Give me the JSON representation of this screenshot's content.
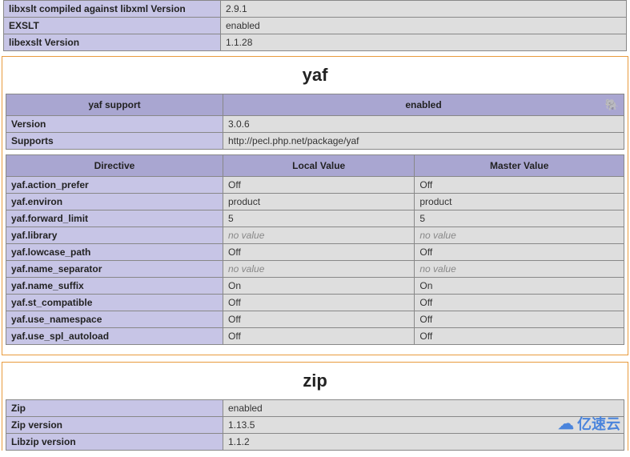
{
  "top_rows": [
    {
      "label": "libxslt compiled against libxml Version",
      "value": "2.9.1"
    },
    {
      "label": "EXSLT",
      "value": "enabled"
    },
    {
      "label": "libexslt Version",
      "value": "1.1.28"
    }
  ],
  "yaf": {
    "title": "yaf",
    "support_header_left": "yaf support",
    "support_header_right": "enabled",
    "info": [
      {
        "label": "Version",
        "value": "3.0.6"
      },
      {
        "label": "Supports",
        "value": "http://pecl.php.net/package/yaf"
      }
    ],
    "headers": {
      "directive": "Directive",
      "local": "Local Value",
      "master": "Master Value"
    },
    "directives": [
      {
        "name": "yaf.action_prefer",
        "local": "Off",
        "master": "Off"
      },
      {
        "name": "yaf.environ",
        "local": "product",
        "master": "product"
      },
      {
        "name": "yaf.forward_limit",
        "local": "5",
        "master": "5"
      },
      {
        "name": "yaf.library",
        "local": "no value",
        "master": "no value",
        "novalue": true
      },
      {
        "name": "yaf.lowcase_path",
        "local": "Off",
        "master": "Off"
      },
      {
        "name": "yaf.name_separator",
        "local": "no value",
        "master": "no value",
        "novalue": true
      },
      {
        "name": "yaf.name_suffix",
        "local": "On",
        "master": "On"
      },
      {
        "name": "yaf.st_compatible",
        "local": "Off",
        "master": "Off"
      },
      {
        "name": "yaf.use_namespace",
        "local": "Off",
        "master": "Off"
      },
      {
        "name": "yaf.use_spl_autoload",
        "local": "Off",
        "master": "Off"
      }
    ]
  },
  "zip": {
    "title": "zip",
    "rows": [
      {
        "label": "Zip",
        "value": "enabled"
      },
      {
        "label": "Zip version",
        "value": "1.13.5"
      },
      {
        "label": "Libzip version",
        "value": "1.1.2"
      }
    ]
  },
  "watermark": "亿速云"
}
